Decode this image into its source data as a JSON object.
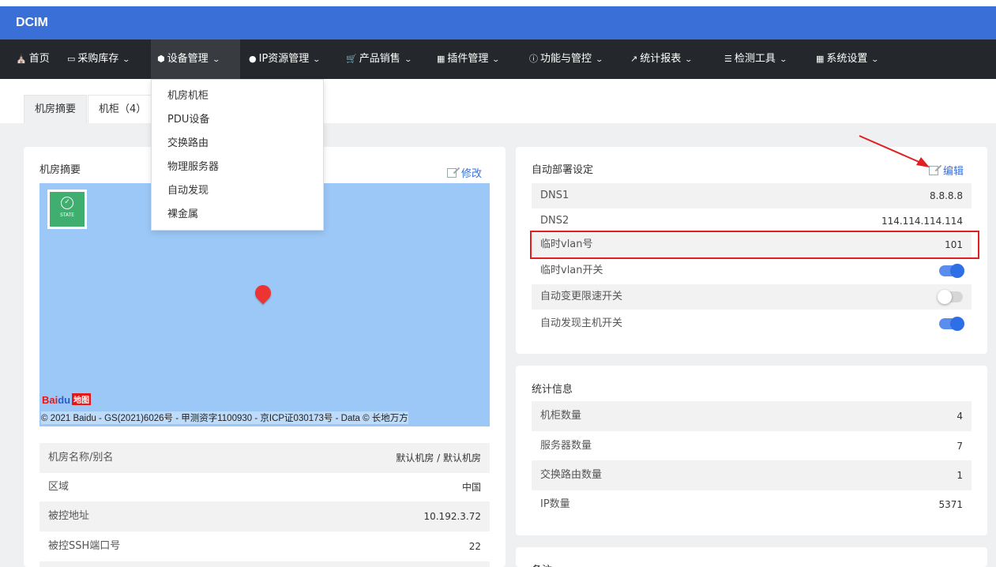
{
  "app": {
    "title": "DCIM"
  },
  "nav": {
    "items": [
      {
        "label": "首页",
        "icon": "home-icon",
        "dropdown": false
      },
      {
        "label": "采购库存",
        "icon": "hdd-icon",
        "dropdown": true
      },
      {
        "label": "设备管理",
        "icon": "cube-icon",
        "dropdown": true,
        "active": true
      },
      {
        "label": "IP资源管理",
        "icon": "map-marker-icon",
        "dropdown": true
      },
      {
        "label": "产品销售",
        "icon": "cart-icon",
        "dropdown": true
      },
      {
        "label": "插件管理",
        "icon": "grid-icon",
        "dropdown": true
      },
      {
        "label": "功能与管控",
        "icon": "info-icon",
        "dropdown": true
      },
      {
        "label": "统计报表",
        "icon": "line-chart-icon",
        "dropdown": true
      },
      {
        "label": "检测工具",
        "icon": "list-icon",
        "dropdown": true
      },
      {
        "label": "系统设置",
        "icon": "windows-icon",
        "dropdown": true
      }
    ],
    "dropdown_items": [
      "机房机柜",
      "PDU设备",
      "交换路由",
      "物理服务器",
      "自动发现",
      "裸金属"
    ]
  },
  "tabs": [
    {
      "label": "机房摘要",
      "active": true
    },
    {
      "label": "机柜（4）",
      "active": false
    }
  ],
  "room_summary": {
    "title": "机房摘要",
    "edit_label": "修改",
    "map": {
      "badge_text": "STATE",
      "logo_text": "Bai",
      "logo_text2": "du",
      "logo_ditu": "地图",
      "copyright": "© 2021 Baidu - GS(2021)6026号 - 甲测资字1100930 - 京ICP证030173号 - Data © 长地万方"
    },
    "fields": [
      {
        "label": "机房名称/别名",
        "value": "默认机房 / 默认机房"
      },
      {
        "label": "区域",
        "value": "中国"
      },
      {
        "label": "被控地址",
        "value": "10.192.3.72"
      },
      {
        "label": "被控SSH端口号",
        "value": "22"
      }
    ]
  },
  "auto_deploy": {
    "title": "自动部署设定",
    "edit_label": "编辑",
    "fields": [
      {
        "label": "DNS1",
        "value": "8.8.8.8"
      },
      {
        "label": "DNS2",
        "value": "114.114.114.114"
      },
      {
        "label": "临时vlan号",
        "value": "101"
      },
      {
        "label": "临时vlan开关",
        "toggle": true
      },
      {
        "label": "自动变更限速开关",
        "toggle": false
      },
      {
        "label": "自动发现主机开关",
        "toggle": true
      }
    ]
  },
  "stats": {
    "title": "统计信息",
    "fields": [
      {
        "label": "机柜数量",
        "value": "4"
      },
      {
        "label": "服务器数量",
        "value": "7"
      },
      {
        "label": "交换路由数量",
        "value": "1"
      },
      {
        "label": "IP数量",
        "value": "5371"
      }
    ]
  },
  "notes": {
    "title": "备注"
  },
  "colors": {
    "brand": "#3a6fd8",
    "nav_bg": "#24272b",
    "toggle_on": "#2e6ee6",
    "annotation": "#e02020"
  }
}
